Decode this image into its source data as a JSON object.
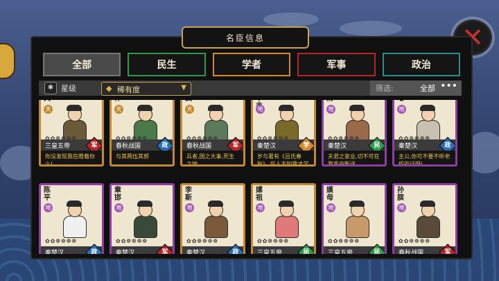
{
  "title": "名臣信息",
  "tabs": [
    {
      "label": "全部",
      "color": "#777777",
      "active": true
    },
    {
      "label": "民生",
      "color": "#2f9a4a",
      "active": false
    },
    {
      "label": "学者",
      "color": "#d38a2c",
      "active": false
    },
    {
      "label": "军事",
      "color": "#b3262a",
      "active": false
    },
    {
      "label": "政治",
      "color": "#2a8e90",
      "active": false
    }
  ],
  "filter": {
    "star_label": "星级",
    "sort_label": "稀有度",
    "filter_label": "筛选:",
    "filter_value": "全部",
    "more": "•••"
  },
  "close_icon": "✕",
  "cards": [
    {
      "name": "天",
      "rank": "天",
      "rank_type": "tian",
      "origin": "三皇五帝",
      "dept": "军",
      "dept_color": "#b3262a",
      "quote": "你没发现我在瞪着你么!",
      "frame": "gold",
      "robe": "#6b5a3a"
    },
    {
      "name": "仲",
      "rank": "天",
      "rank_type": "tian",
      "origin": "春秋战国",
      "dept": "政",
      "dept_color": "#2a6fb3",
      "quote": "与其两伍其郭",
      "frame": "gold",
      "robe": "#4a7a4a"
    },
    {
      "name": "武",
      "rank": "天",
      "rank_type": "tian",
      "origin": "春秋战国",
      "dept": "军",
      "dept_color": "#b3262a",
      "quote": "兵者,国之大事,死生之地",
      "frame": "gold",
      "robe": "#5a7a5a"
    },
    {
      "name": "不韦",
      "rank": "地",
      "rank_type": "di",
      "origin": "秦楚汉",
      "dept": "学",
      "dept_color": "#d38a2c",
      "quote": "岁与著有《吕氏春秋》,后人方知我才学",
      "frame": "gold",
      "robe": "#7a6a2a"
    },
    {
      "name": "清",
      "rank": "地",
      "rank_type": "di",
      "origin": "秦楚汉",
      "dept": "民",
      "dept_color": "#2f9a4a",
      "quote": "夫君之家业,切不可在我手中断送",
      "frame": "purple",
      "robe": "#9a6a4a"
    },
    {
      "name": "增",
      "rank": "地",
      "rank_type": "di",
      "origin": "秦楚汉",
      "dept": "政",
      "dept_color": "#2a6fb3",
      "quote": "主公,你可不要不听老朽的话呀!",
      "frame": "purple",
      "robe": "#c8c0b0"
    },
    {
      "name": "陈平",
      "rank": "地",
      "rank_type": "di",
      "origin": "秦楚汉",
      "dept": "政",
      "dept_color": "#2a6fb3",
      "quote": "",
      "frame": "purple",
      "robe": "#f0f0f0"
    },
    {
      "name": "章邯",
      "rank": "地",
      "rank_type": "di",
      "origin": "秦楚汉",
      "dept": "军",
      "dept_color": "#b3262a",
      "quote": "",
      "frame": "purple",
      "robe": "#3a4a3a"
    },
    {
      "name": "李斯",
      "rank": "地",
      "rank_type": "di",
      "origin": "秦楚汉",
      "dept": "政",
      "dept_color": "#2a6fb3",
      "quote": "",
      "frame": "gold",
      "robe": "#7a5a3a"
    },
    {
      "name": "嫘祖",
      "rank": "地",
      "rank_type": "di",
      "origin": "三皇五帝",
      "dept": "民",
      "dept_color": "#2f9a4a",
      "quote": "",
      "frame": "gold",
      "robe": "#e07a7a"
    },
    {
      "name": "嫫母",
      "rank": "地",
      "rank_type": "di",
      "origin": "三皇五帝",
      "dept": "民",
      "dept_color": "#2f9a4a",
      "quote": "",
      "frame": "purple",
      "robe": "#c89a6a"
    },
    {
      "name": "孙膑",
      "rank": "地",
      "rank_type": "di",
      "origin": "春秋战国",
      "dept": "军",
      "dept_color": "#b3262a",
      "quote": "",
      "frame": "purple",
      "robe": "#5a4a3a"
    }
  ],
  "pips": "✿✿❁❁❁❁"
}
